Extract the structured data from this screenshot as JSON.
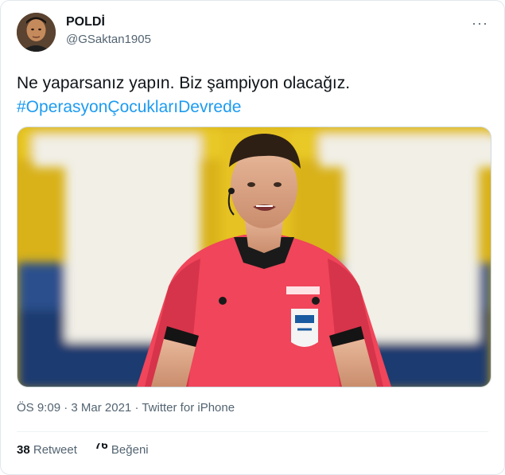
{
  "author": {
    "display_name": "POLDİ",
    "handle": "@GSaktan1905"
  },
  "more_label": "···",
  "tweet": {
    "text": "Ne yaparsanız yapın. Biz şampiyon olacağız.",
    "hashtag": "#OperasyonÇocuklarıDevrede"
  },
  "meta": {
    "time": "ÖS 9:09",
    "sep1": " · ",
    "date": "3 Mar 2021",
    "sep2": " · ",
    "source": "Twitter for iPhone"
  },
  "stats": {
    "retweets_count": "38",
    "retweets_label": "Retweet",
    "likes_count": "76",
    "likes_label": "Beğeni"
  },
  "colors": {
    "accent": "#1d9bf0",
    "text": "#0f1419",
    "muted": "#536471",
    "jersey": "#f0455a",
    "stadium_yellow": "#e9c51c",
    "stadium_blue": "#2c4f8c"
  }
}
